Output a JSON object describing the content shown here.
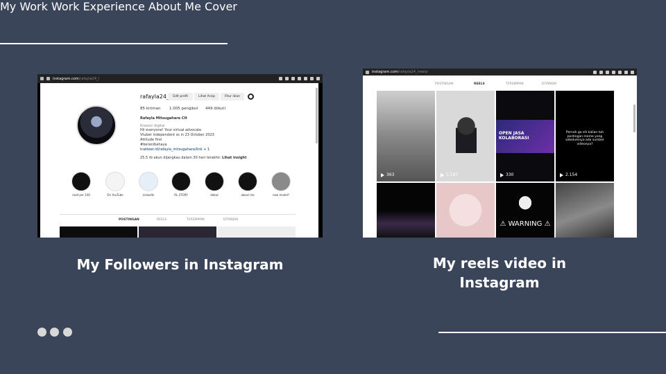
{
  "nav": {
    "items": [
      "My Work",
      "Work Experience",
      "About Me",
      "Cover"
    ]
  },
  "left_shot": {
    "url_domain": "instagram.com",
    "url_path": "/rafayla24_/",
    "username": "rafayla24_",
    "btn_edit": "Edit profil",
    "btn_archive": "Lihat Arsip",
    "btn_ads": "Fitur iklan",
    "posts": "85 kiriman",
    "followers": "1.005 pengikut",
    "following": "449 diikuti",
    "full_name": "Rafayla Mitsugahara CH",
    "category": "Kreator digital",
    "bio1": "Hii everyone! Your virtual advocate",
    "bio2": "Vtuber independent ss in 23 October 2023",
    "bio3": "Attitude first",
    "bio4": "#beranibahaya",
    "link": "trakteer.id/rafayla_mitsugahara/link + 1",
    "insight": "25,5 rb akun dijangkau dalam 30 hari terakhir.",
    "insight_link": "Lihat insight",
    "stories": [
      "read per 100",
      "On YouTube",
      "LinkedIn",
      "RL STORY",
      "debut",
      "about me",
      "new model?"
    ],
    "tabs": [
      "POSTINGAN",
      "REELS",
      "TERSIMPAN",
      "DITANDAI"
    ]
  },
  "right_shot": {
    "url_domain": "instagram.com",
    "url_path": "/rafayla24_/reels/",
    "tabs": [
      "POSTINGAN",
      "REELS",
      "TERSIMPAN",
      "DITANDAI"
    ],
    "views": [
      "363",
      "1.165",
      "330",
      "2.154"
    ],
    "reel3_text": "OPEN JASA KOLABORASI",
    "reel4_text": "Pernah ga sih kalian tuh postingan meme yang sebelumnya ada sumber videonya?",
    "warning_text": "WARNING"
  },
  "captions": {
    "left": "My Followers in Instagram",
    "right": "My reels video in Instagram"
  },
  "colors": {
    "background": "#3b4559",
    "accent": "#ffffff",
    "dots": "#d8d8d8"
  }
}
